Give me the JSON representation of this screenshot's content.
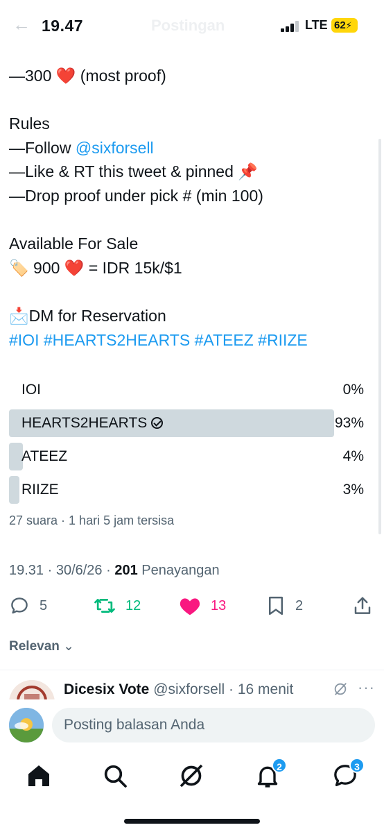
{
  "status_bar": {
    "time": "19.47",
    "screen_title": "Postingan",
    "network": "LTE",
    "battery": "62"
  },
  "tweet": {
    "lines": [
      {
        "parts": [
          "—300 ",
          "❤️",
          " (most proof)"
        ]
      },
      {
        "blank": true
      },
      {
        "text": "Rules"
      },
      {
        "prefix": "—Follow ",
        "mention": "@sixforsell"
      },
      {
        "text": "—Like & RT this tweet & pinned 📌"
      },
      {
        "text": "—Drop proof under pick # (min 100)"
      },
      {
        "blank": true
      },
      {
        "text": "Available For Sale"
      },
      {
        "parts": [
          "🏷️ 900 ",
          "❤️",
          " = IDR 15k/$1"
        ]
      },
      {
        "blank": true
      },
      {
        "text": "📩DM for Reservation"
      },
      {
        "hashtags": "#IOI #HEARTS2HEARTS #ATEEZ #RIIZE"
      }
    ]
  },
  "poll": {
    "options": [
      {
        "label": "IOI",
        "percent": "0%",
        "fraction": 0.0,
        "winner": false
      },
      {
        "label": "HEARTS2HEARTS",
        "percent": "93%",
        "fraction": 0.93,
        "winner": true
      },
      {
        "label": "ATEEZ",
        "percent": "4%",
        "fraction": 0.04,
        "winner": false
      },
      {
        "label": "RIIZE",
        "percent": "3%",
        "fraction": 0.03,
        "winner": false
      }
    ],
    "meta": "27 suara · 1 hari 5 jam tersisa"
  },
  "timestamp": {
    "datetime": "19.31 · 30/6/26 · ",
    "views_count": "201",
    "views_label": " Penayangan"
  },
  "actions": {
    "replies": "5",
    "reposts": "12",
    "likes": "13",
    "bookmarks": "2"
  },
  "colors": {
    "accent": "#1d9bf0",
    "repost": "#00ba7c",
    "like": "#f91880",
    "muted": "#536471"
  },
  "sort_label": "Relevan",
  "reply_preview": {
    "name": "Dicesix Vote",
    "handle": "@sixforsell · 16 menit"
  },
  "composer": {
    "placeholder": "Posting balasan Anda"
  },
  "nav": {
    "notifications_badge": "2",
    "messages_badge": "3"
  }
}
